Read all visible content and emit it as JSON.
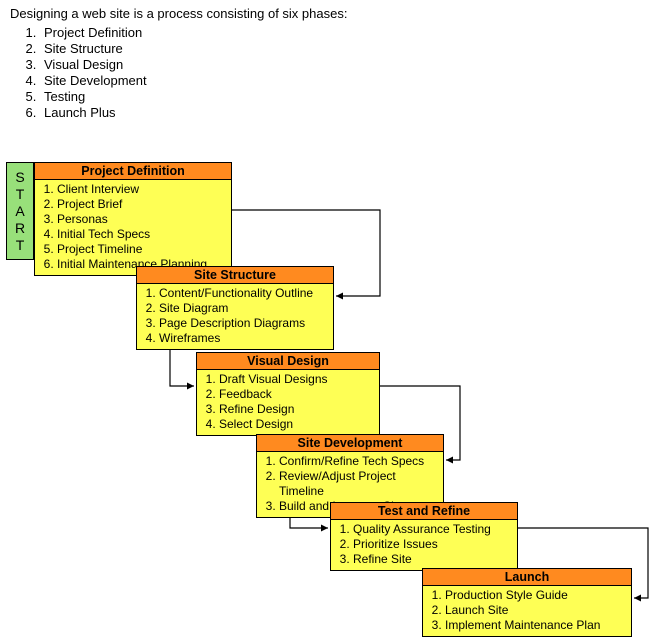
{
  "intro": {
    "lead": "Designing a web site is a process consisting of six phases:",
    "phases": [
      "Project Definition",
      "Site Structure",
      "Visual Design",
      "Site Development",
      "Testing",
      "Launch Plus"
    ]
  },
  "start_label": {
    "c0": "S",
    "c1": "T",
    "c2": "A",
    "c3": "R",
    "c4": "T"
  },
  "boxes": {
    "b1": {
      "title": "Project Definition",
      "items": [
        "Client Interview",
        "Project Brief",
        "Personas",
        "Initial Tech Specs",
        "Project Timeline",
        "Initial Maintenance Planning"
      ]
    },
    "b2": {
      "title": "Site Structure",
      "items": [
        "Content/Functionality Outline",
        "Site Diagram",
        "Page Description Diagrams",
        "Wireframes"
      ]
    },
    "b3": {
      "title": "Visual Design",
      "items": [
        "Draft Visual Designs",
        "Feedback",
        "Refine Design",
        "Select Design"
      ]
    },
    "b4": {
      "title": "Site Development",
      "items": [
        "Confirm/Refine Tech Specs",
        "Review/Adjust Project Timeline",
        "Build and Integrate Site"
      ]
    },
    "b5": {
      "title": "Test and Refine",
      "items": [
        "Quality Assurance Testing",
        "Prioritize Issues",
        "Refine Site"
      ]
    },
    "b6": {
      "title": "Launch",
      "items": [
        "Production Style Guide",
        "Launch Site",
        "Implement Maintenance Plan"
      ]
    }
  }
}
